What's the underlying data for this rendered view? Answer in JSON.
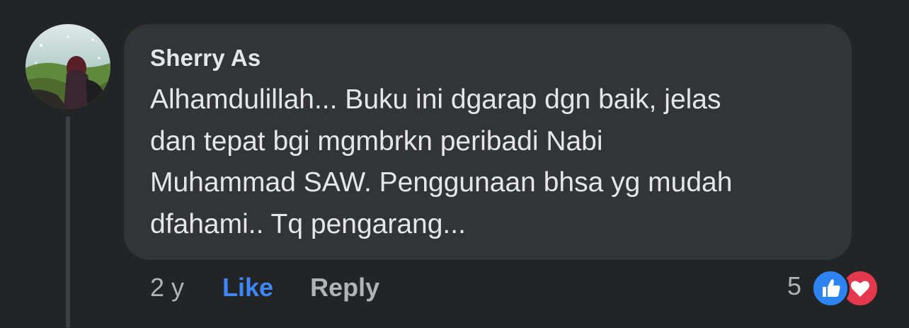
{
  "comment": {
    "author": "Sherry As",
    "text_lines": [
      "Alhamdulillah... Buku ini dgarap dgn baik, jelas",
      "dan tepat bgi mgmbrkn peribadi Nabi",
      "Muhammad SAW. Penggunaan bhsa yg mudah",
      "dfahami.. Tq pengarang..."
    ],
    "timestamp": "2 y",
    "like_label": "Like",
    "reply_label": "Reply",
    "reaction_count": "5",
    "reaction_icons": [
      "like-reaction-icon",
      "love-reaction-icon"
    ]
  },
  "colors": {
    "background": "#232425",
    "bubble": "#333435",
    "text": "#e4e6eb",
    "secondary": "#b0b3b8",
    "like_blue": "#3f86f7",
    "love_red": "#e4384f"
  }
}
